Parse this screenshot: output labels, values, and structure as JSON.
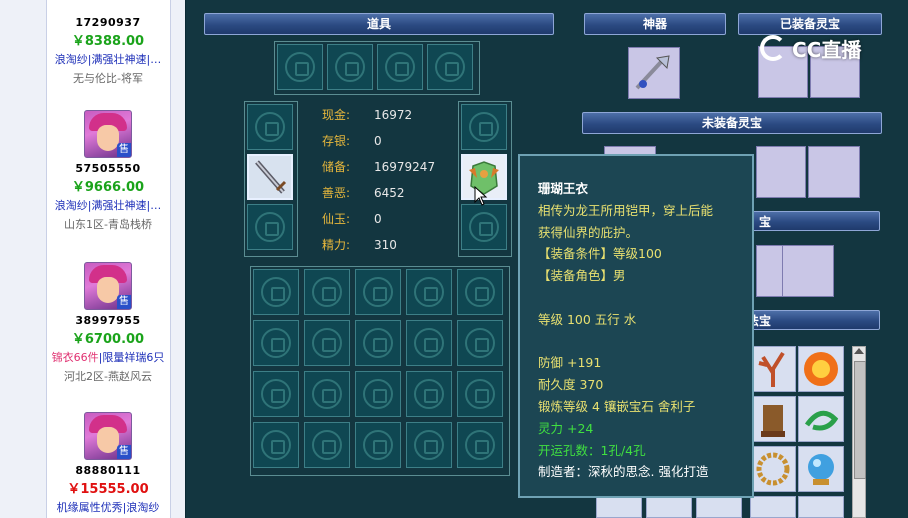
{
  "left_listings": [
    {
      "id": "17290937",
      "price": "￥8388.00",
      "price_color": "#1aa31a",
      "tags": "浪淘纱|满强壮神速|…",
      "tags_pink_prefix": "",
      "server": "无与伦比-将军"
    },
    {
      "id": "57505550",
      "price": "￥9666.00",
      "price_color": "#1aa31a",
      "tags": "浪淘纱|满强壮神速|…",
      "tags_pink_prefix": "",
      "server": "山东1区-青岛栈桥"
    },
    {
      "id": "38997955",
      "price": "￥6700.00",
      "price_color": "#1aa31a",
      "tags": "|限量祥瑞6只",
      "tags_pink_prefix": "锦衣66件",
      "server": "河北2区-燕赵风云"
    },
    {
      "id": "88880111",
      "price": "￥15555.00",
      "price_color": "#e01010",
      "tags": "机缘属性优秀|浪淘纱",
      "tags_pink_prefix": "",
      "server": ""
    }
  ],
  "sell_badge": "售",
  "headers": {
    "items": "道具",
    "artifact": "神器",
    "equipped_treasure": "已装备灵宝",
    "unequipped_treasure": "未装备灵宝",
    "partial_treasure": "宝",
    "partial_magic": "法宝"
  },
  "stats": [
    {
      "key": "现金:",
      "value": "16972"
    },
    {
      "key": "存银:",
      "value": "0"
    },
    {
      "key": "储备:",
      "value": "16979247"
    },
    {
      "key": "善恶:",
      "value": "6452"
    },
    {
      "key": "仙玉:",
      "value": "0"
    },
    {
      "key": "精力:",
      "value": "310"
    }
  ],
  "tooltip": {
    "name": "珊瑚王衣",
    "desc1": "相传为龙王所用铠甲，穿上后能",
    "desc2": "获得仙界的庇护。",
    "req_level": "【装备条件】等级100",
    "req_role": "【装备角色】男",
    "level_line": "等级 100 五行 水",
    "defense": "防御 +191",
    "durability": "耐久度 370",
    "forge": "锻炼等级 4 镶嵌宝石 舍利子",
    "spirit": "灵力 +24",
    "luck_holes": "开运孔数：1孔/4孔",
    "maker": "制造者：深秋的思念. 强化打造"
  },
  "watermark": "CC直播",
  "colors": {
    "header_blue": "#2b4a82",
    "tooltip_bg": "#1c4653",
    "stat_key": "#e6b73c",
    "tooltip_text": "#e8e070",
    "green_text": "#40e040"
  }
}
